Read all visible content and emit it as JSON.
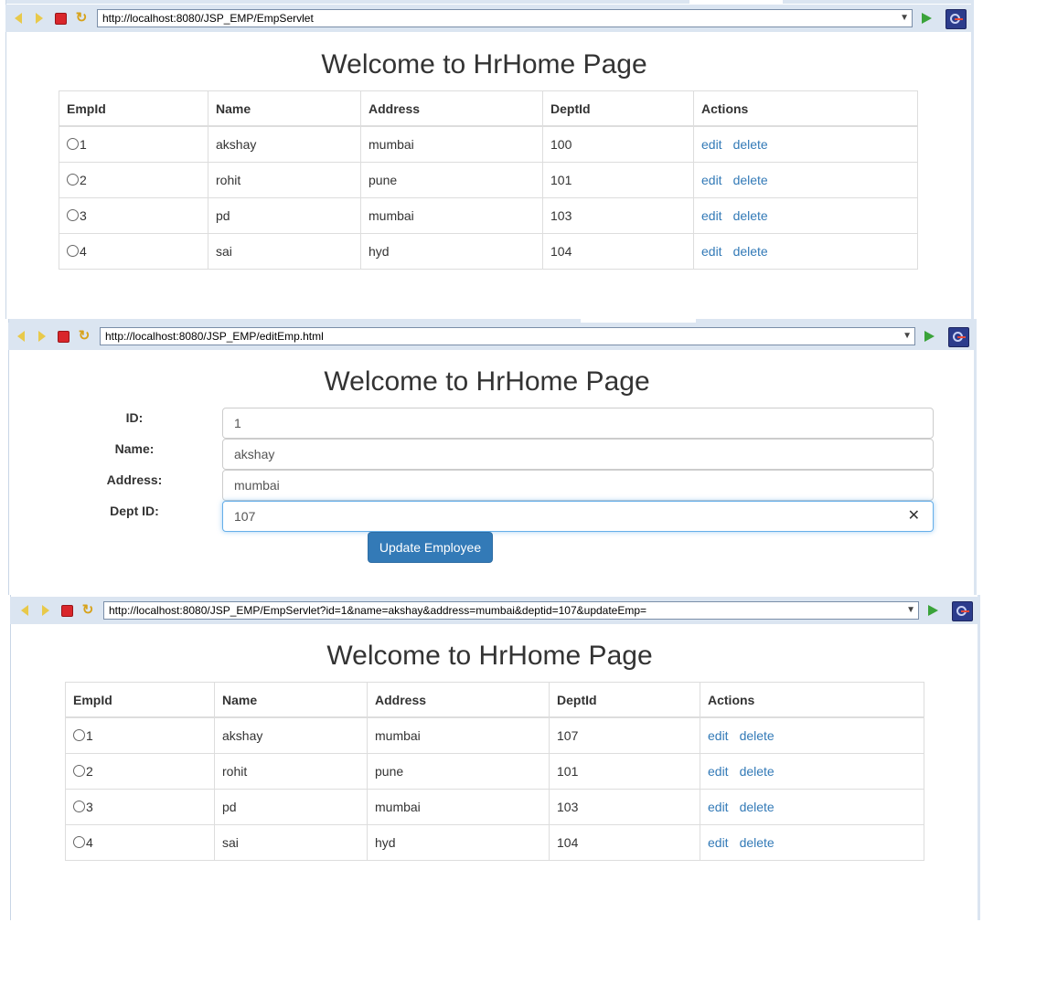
{
  "panels": [
    {
      "url": "http://localhost:8080/JSP_EMP/EmpServlet",
      "title": "Welcome to HrHome Page",
      "table": {
        "headers": [
          "EmpId",
          "Name",
          "Address",
          "DeptId",
          "Actions"
        ],
        "rows": [
          {
            "id": "1",
            "name": "akshay",
            "address": "mumbai",
            "dept": "100"
          },
          {
            "id": "2",
            "name": "rohit",
            "address": "pune",
            "dept": "101"
          },
          {
            "id": "3",
            "name": "pd",
            "address": "mumbai",
            "dept": "103"
          },
          {
            "id": "4",
            "name": "sai",
            "address": "hyd",
            "dept": "104"
          }
        ],
        "edit_label": "edit",
        "delete_label": "delete"
      }
    },
    {
      "url": "http://localhost:8080/JSP_EMP/editEmp.html",
      "title": "Welcome to HrHome Page",
      "form": {
        "id_label": "ID:",
        "id_value": "1",
        "name_label": "Name:",
        "name_value": "akshay",
        "address_label": "Address:",
        "address_value": "mumbai",
        "dept_label": "Dept ID:",
        "dept_value": "107",
        "submit_label": "Update Employee",
        "clear_glyph": "✕"
      }
    },
    {
      "url": "http://localhost:8080/JSP_EMP/EmpServlet?id=1&name=akshay&address=mumbai&deptid=107&updateEmp=",
      "title": "Welcome to HrHome Page",
      "table": {
        "headers": [
          "EmpId",
          "Name",
          "Address",
          "DeptId",
          "Actions"
        ],
        "rows": [
          {
            "id": "1",
            "name": "akshay",
            "address": "mumbai",
            "dept": "107"
          },
          {
            "id": "2",
            "name": "rohit",
            "address": "pune",
            "dept": "101"
          },
          {
            "id": "3",
            "name": "pd",
            "address": "mumbai",
            "dept": "103"
          },
          {
            "id": "4",
            "name": "sai",
            "address": "hyd",
            "dept": "104"
          }
        ],
        "edit_label": "edit",
        "delete_label": "delete"
      }
    }
  ],
  "icons": {
    "back": "back-arrow-icon",
    "forward": "forward-arrow-icon",
    "stop": "stop-icon",
    "refresh": "refresh-icon",
    "go": "go-icon",
    "eclipse": "eclipse-icon",
    "dropdown": "▼",
    "refresh_glyph": "↻"
  },
  "colors": {
    "toolbar_bg": "#dbe5f1",
    "link": "#337ab7",
    "button": "#337ab7",
    "stop": "#d9262b",
    "go": "#3aa33a"
  }
}
